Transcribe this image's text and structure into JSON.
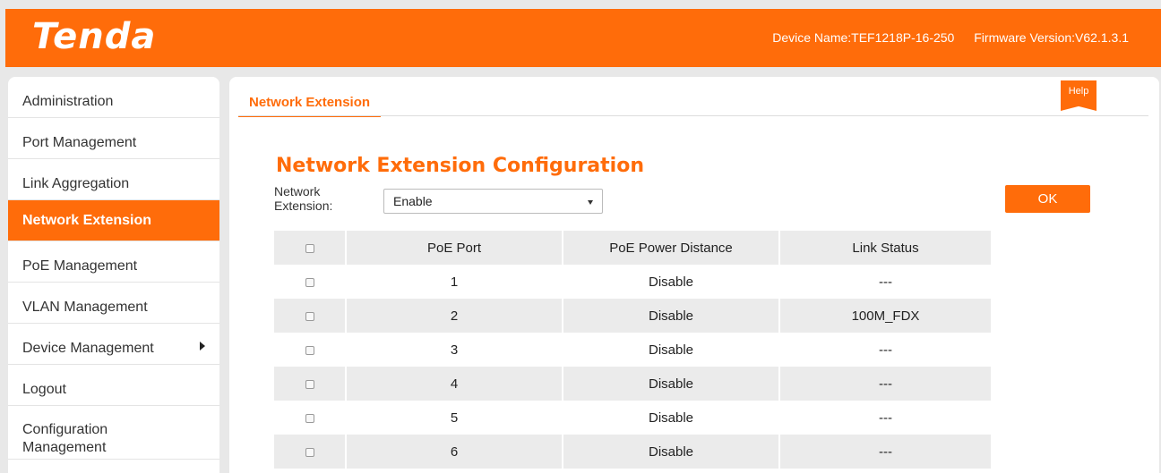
{
  "header": {
    "logo": "Tenda",
    "device_name": "Device Name:TEF1218P-16-250",
    "firmware_version": "Firmware Version:V62.1.3.1"
  },
  "sidebar": {
    "items": [
      {
        "label": "Administration",
        "active": false
      },
      {
        "label": "Port Management",
        "active": false
      },
      {
        "label": "Link Aggregation",
        "active": false
      },
      {
        "label": "Network Extension",
        "active": true
      },
      {
        "label": "PoE Management",
        "active": false
      },
      {
        "label": "VLAN Management",
        "active": false
      },
      {
        "label": "Device Management",
        "active": false,
        "submenu_icon": "triangle-right-icon"
      },
      {
        "label": "Logout",
        "active": false
      },
      {
        "label": "Configuration Management",
        "active": false
      }
    ]
  },
  "main": {
    "tab_label": "Network Extension",
    "help_label": "Help",
    "page_title": "Network Extension Configuration",
    "network_extension_label": "Network Extension:",
    "network_extension_value": "Enable",
    "ok_label": "OK",
    "table": {
      "headers": [
        "",
        "PoE Port",
        "PoE Power Distance",
        "Link Status"
      ],
      "rows": [
        {
          "port": "1",
          "distance": "Disable",
          "status": "---"
        },
        {
          "port": "2",
          "distance": "Disable",
          "status": "100M_FDX"
        },
        {
          "port": "3",
          "distance": "Disable",
          "status": "---"
        },
        {
          "port": "4",
          "distance": "Disable",
          "status": "---"
        },
        {
          "port": "5",
          "distance": "Disable",
          "status": "---"
        },
        {
          "port": "6",
          "distance": "Disable",
          "status": "---"
        }
      ]
    }
  },
  "colors": {
    "accent": "#ff6c0a",
    "row_alt": "#ebebeb"
  }
}
